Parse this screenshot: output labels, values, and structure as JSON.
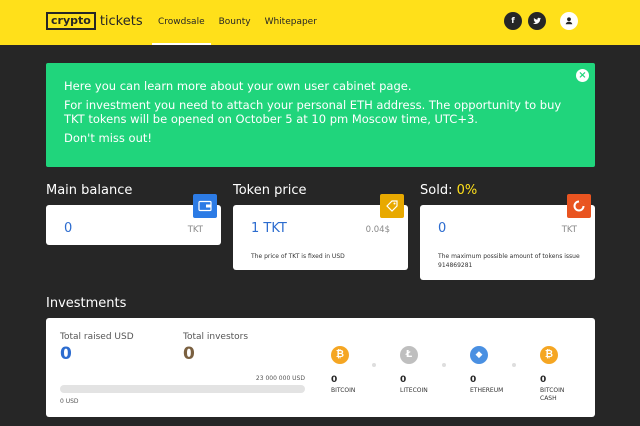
{
  "header": {
    "logo_box": "crypto",
    "logo_text": "tickets",
    "nav": [
      {
        "label": "Crowdsale",
        "active": true
      },
      {
        "label": "Bounty",
        "active": false
      },
      {
        "label": "Whitepaper",
        "active": false
      }
    ],
    "social": {
      "facebook": "f",
      "twitter": "t",
      "user": "user-icon"
    }
  },
  "notice": {
    "lines": [
      "Here you can learn more about your own user cabinet page.",
      "For investment you need to attach your personal ETH address. The opportunity to buy TKT tokens will be opened on October 5 at 10 pm Moscow time, UTC+3.",
      "Don't miss out!"
    ],
    "close": "×"
  },
  "main_balance": {
    "title": "Main balance",
    "value": "0",
    "unit": "TKT",
    "icon": "wallet-icon",
    "icon_color": "#2c7be5"
  },
  "token_price": {
    "title": "Token price",
    "value": "1 TKT",
    "unit": "0.04$",
    "note": "The price of TKT is fixed in USD",
    "icon": "tag-icon",
    "icon_color": "#e8a900"
  },
  "sold": {
    "title": "Sold: ",
    "percent": "0%",
    "value": "0",
    "unit": "TKT",
    "note_line1": "The maximum possible amount of tokens issue",
    "note_line2": "914869281",
    "icon": "pie-icon",
    "icon_color": "#e95420"
  },
  "investments": {
    "title": "Investments",
    "raised_label": "Total raised USD",
    "raised_value": "0",
    "investors_label": "Total investors",
    "investors_value": "0",
    "goal": "23 000 000 USD",
    "current": "0 USD",
    "progress": 0,
    "coins": [
      {
        "symbol": "₿",
        "value": "0",
        "name": "BITCOIN",
        "color": "#f5a623",
        "icon": "bitcoin-icon"
      },
      {
        "symbol": "Ł",
        "value": "0",
        "name": "LITECOIN",
        "color": "#bfbfbf",
        "icon": "litecoin-icon"
      },
      {
        "symbol": "◆",
        "value": "0",
        "name": "ETHEREUM",
        "color": "#4a90e2",
        "icon": "ethereum-icon"
      },
      {
        "symbol": "₿",
        "value": "0",
        "name": "BITCOIN",
        "name2": "CASH",
        "color": "#f5a623",
        "icon": "bitcoin-cash-icon"
      }
    ]
  }
}
